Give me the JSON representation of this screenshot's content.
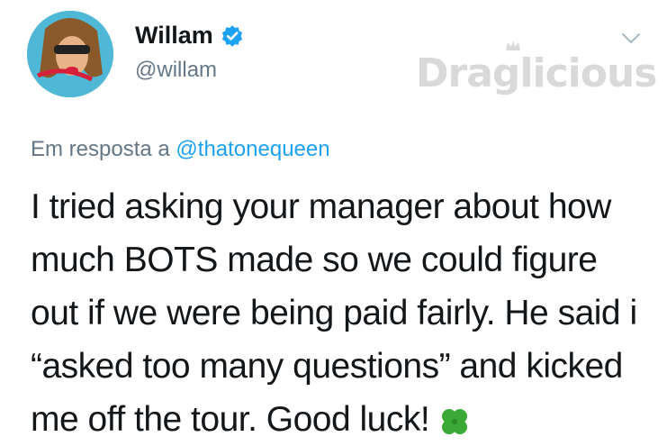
{
  "author": {
    "name": "Willam",
    "handle": "@willam",
    "verified": true,
    "avatar_icon": "avatar-illustration-icon"
  },
  "watermark": {
    "text": "Draglicious"
  },
  "reply": {
    "prefix": "Em resposta a",
    "mention": "@thatonequeen"
  },
  "tweet": {
    "text": "I tried asking your manager about how much BOTS made so we could figure out if we were being paid fairly. He said i “asked too many questions” and kicked me off the tour. Good luck!",
    "emoji_icon": "four-leaf-clover-icon"
  },
  "colors": {
    "accent": "#1da1f2",
    "secondary_text": "#657786",
    "primary_text": "#14171a"
  }
}
